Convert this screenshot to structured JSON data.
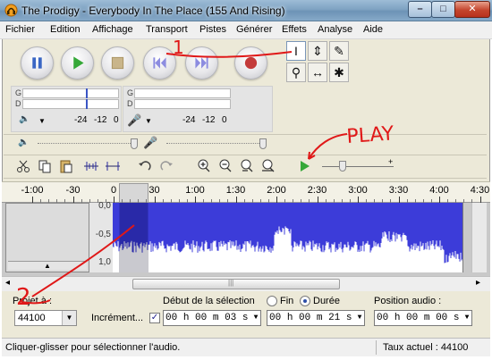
{
  "window": {
    "title": "The Prodigy - Everybody In The Place (155 And Rising)",
    "min_glyph": "–",
    "max_glyph": "□",
    "close_glyph": "✕"
  },
  "menu": [
    "Fichier",
    "Edition",
    "Affichage",
    "Transport",
    "Pistes",
    "Générer",
    "Effets",
    "Analyse",
    "Aide"
  ],
  "tools": {
    "selection": "I",
    "envelope": "⇕",
    "draw": "✎",
    "zoom": "⚲",
    "timeshift": "↔",
    "multi": "✱"
  },
  "meters": {
    "record_channels": [
      "G",
      "D"
    ],
    "play_channels": [
      "G",
      "D"
    ],
    "record_ticks": [
      "-24",
      "-12",
      "0"
    ],
    "play_ticks": [
      "-24",
      "-12",
      "0"
    ],
    "speaker_glyph": "🔈",
    "mic_glyph": "🎤",
    "dropdown_glyph": "▼"
  },
  "colors": {
    "waveform": "#3c3cd9",
    "waveform_dark": "#2929a8",
    "selection": "#c9c9cf",
    "annotation": "#e01818"
  },
  "ruler": {
    "labels": [
      "-1:00",
      "-30",
      "0",
      "30",
      "1:00",
      "1:30",
      "2:00",
      "2:30",
      "3:00",
      "3:30",
      "4:00",
      "4:30"
    ]
  },
  "track": {
    "y_labels": [
      "0,0",
      "-0,5",
      "1,0"
    ],
    "collapse_glyph": "▲",
    "selection_start_s": 3,
    "selection_end_s": 21
  },
  "scroll": {
    "left": "◂",
    "right": "▸",
    "grip": "|||"
  },
  "selection_bar": {
    "project_rate_label": "Projet à :",
    "project_rate_value": "44100",
    "snap_label": "Incrément...",
    "snap_checked": "✓",
    "sel_start_label": "Début de la sélection",
    "end_label": "Fin",
    "duration_label": "Durée",
    "audio_pos_label": "Position audio :",
    "sel_start": {
      "h": "00",
      "m": "03",
      "hour_unit": "h",
      "min_unit": "m",
      "sec_unit": "s",
      "hours": "0",
      "min": "00"
    },
    "duration": {
      "h": "00",
      "m": "21"
    },
    "audio_pos": {
      "m": "00"
    }
  },
  "status": {
    "left": "Cliquer-glisser pour sélectionner l'audio.",
    "right": "Taux actuel : 44100"
  },
  "annotations": {
    "play_text": "PLAY",
    "one_text": "1",
    "two_text": "2"
  }
}
